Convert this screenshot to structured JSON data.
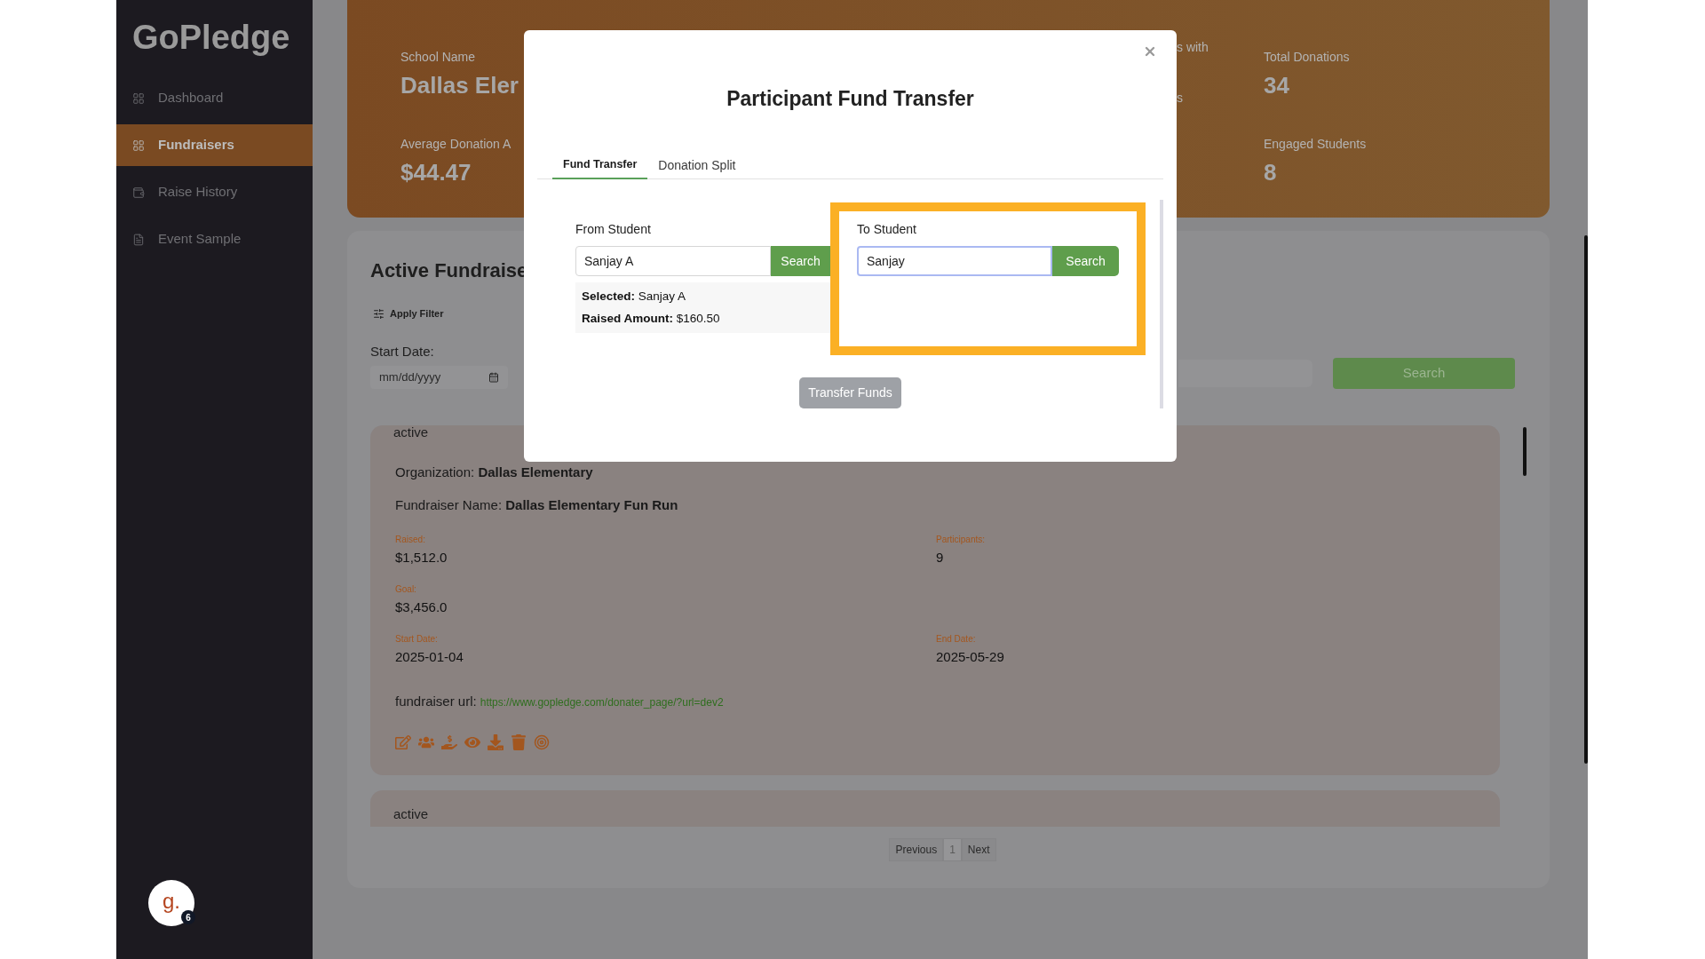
{
  "sidebar": {
    "logo": "GoPledge",
    "items": [
      {
        "label": "Dashboard",
        "kind": "grid",
        "selected": false
      },
      {
        "label": "Fundraisers",
        "kind": "grid",
        "selected": true
      },
      {
        "label": "Raise History",
        "kind": "wallet",
        "selected": false
      },
      {
        "label": "Event Sample",
        "kind": "document",
        "selected": false
      }
    ],
    "avatar": {
      "letter": "g.",
      "badge": "6"
    }
  },
  "header": {
    "stat_columns": [
      [
        {
          "label": "School Name",
          "value": "Dallas Eler"
        },
        {
          "label": "Average Donation A",
          "value": "$44.47"
        }
      ],
      [
        {
          "label": "s with"
        },
        {
          "label": "s"
        }
      ],
      [
        {
          "label": "Total Donations",
          "value": "34"
        },
        {
          "label": "Engaged Students",
          "value": "8"
        }
      ]
    ]
  },
  "panel": {
    "title": "Active Fundraise",
    "filter": "Apply Filter",
    "start_date_label": "Start Date:",
    "date_placeholder": "mm/dd/yyyy",
    "search_button": "Search",
    "fundraisers": [
      {
        "status": "active",
        "organization": {
          "label": "Organization:",
          "value": "Dallas Elementary"
        },
        "name": {
          "label": "Fundraiser Name:",
          "value": "Dallas Elementary Fun Run"
        },
        "stat_rows": [
          [
            {
              "label": "Raised:",
              "value": "$1,512.0"
            },
            {
              "label": "Participants:",
              "value": "9"
            }
          ],
          [
            {
              "label": "Goal:",
              "value": "$3,456.0"
            }
          ],
          [
            {
              "label": "Start Date:",
              "value": "2025-01-04"
            },
            {
              "label": "End Date:",
              "value": "2025-05-29"
            }
          ]
        ],
        "url": {
          "label": "fundraiser url:",
          "link": "https://www.gopledge.com/donater_page/?url=dev2"
        }
      },
      {
        "status": "active"
      }
    ],
    "pagination": {
      "previous": "Previous",
      "pages": [
        {
          "label": "1",
          "selected": true
        }
      ],
      "next": "Next"
    }
  },
  "modal": {
    "title": "Participant Fund Transfer",
    "tabs": [
      {
        "label": "Fund Transfer",
        "selected": true
      },
      {
        "label": "Donation Split",
        "selected": false
      }
    ],
    "from": {
      "label": "From Student",
      "value": "Sanjay A",
      "button": "Search",
      "selection": [
        "**Selected:** Sanjay A",
        "**Raised Amount:** $160.50"
      ]
    },
    "to": {
      "label": "To Student",
      "value": "Sanjay",
      "button": "Search",
      "focused": true,
      "highlighted": true
    },
    "transfer_button": {
      "label": "Transfer Funds",
      "disabled": true
    }
  }
}
